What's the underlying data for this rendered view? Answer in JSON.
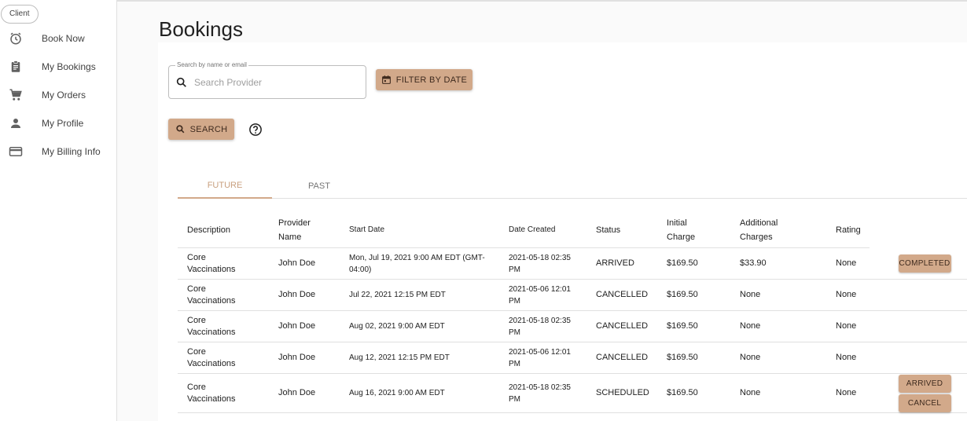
{
  "sidebar": {
    "role": "Client",
    "items": [
      {
        "label": "Book Now",
        "icon": "clock-icon"
      },
      {
        "label": "My Bookings",
        "icon": "clipboard-icon"
      },
      {
        "label": "My Orders",
        "icon": "cart-icon"
      },
      {
        "label": "My Profile",
        "icon": "person-icon"
      },
      {
        "label": "My Billing Info",
        "icon": "credit-card-icon"
      }
    ]
  },
  "page": {
    "title": "Bookings"
  },
  "search": {
    "legend": "Search by name or email",
    "placeholder": "Search Provider",
    "value": "",
    "filter_label": "Filter by date",
    "search_label": "Search"
  },
  "tabs": {
    "future": "Future",
    "past": "Past",
    "active": "future"
  },
  "table": {
    "headers": {
      "description": "Description",
      "provider": "Provider Name",
      "start": "Start Date",
      "created": "Date Created",
      "status": "Status",
      "initial": "Initial Charge",
      "additional": "Additional Charges",
      "rating": "Rating"
    },
    "rows": [
      {
        "description": "Core Vaccinations",
        "provider": "John Doe",
        "start": "Mon, Jul 19, 2021 9:00 AM EDT (GMT-04:00)",
        "created": "2021-05-18 02:35 PM",
        "status": "ARRIVED",
        "initial": "$169.50",
        "additional": "$33.90",
        "rating": "None",
        "actions": [
          "Completed"
        ]
      },
      {
        "description": "Core Vaccinations",
        "provider": "John Doe",
        "start": "Jul 22, 2021 12:15 PM EDT",
        "created": "2021-05-06 12:01 PM",
        "status": "CANCELLED",
        "initial": "$169.50",
        "additional": "None",
        "rating": "None",
        "actions": []
      },
      {
        "description": "Core Vaccinations",
        "provider": "John Doe",
        "start": "Aug 02, 2021 9:00 AM EDT",
        "created": "2021-05-18 02:35 PM",
        "status": "CANCELLED",
        "initial": "$169.50",
        "additional": "None",
        "rating": "None",
        "actions": []
      },
      {
        "description": "Core Vaccinations",
        "provider": "John Doe",
        "start": "Aug 12, 2021 12:15 PM EDT",
        "created": "2021-05-06 12:01 PM",
        "status": "CANCELLED",
        "initial": "$169.50",
        "additional": "None",
        "rating": "None",
        "actions": []
      },
      {
        "description": "Core Vaccinations",
        "provider": "John Doe",
        "start": "Aug 16, 2021 9:00 AM EDT",
        "created": "2021-05-18 02:35 PM",
        "status": "SCHEDULED",
        "initial": "$169.50",
        "additional": "None",
        "rating": "None",
        "actions": [
          "Arrived",
          "Cancel"
        ]
      }
    ]
  },
  "colors": {
    "accent": "#d2a98a",
    "accent_text": "#c9a07f"
  }
}
